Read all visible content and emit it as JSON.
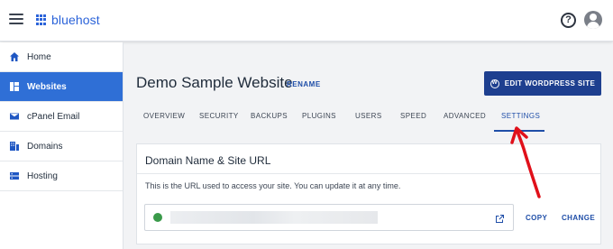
{
  "header": {
    "brand": "bluehost"
  },
  "sidebar": {
    "items": [
      {
        "label": "Home",
        "icon": "home-icon",
        "active": false
      },
      {
        "label": "Websites",
        "icon": "websites-icon",
        "active": true
      },
      {
        "label": "cPanel Email",
        "icon": "email-icon",
        "active": false
      },
      {
        "label": "Domains",
        "icon": "domains-icon",
        "active": false
      },
      {
        "label": "Hosting",
        "icon": "hosting-icon",
        "active": false
      }
    ]
  },
  "page": {
    "title": "Demo Sample Website",
    "rename_label": "RENAME",
    "edit_button_label": "EDIT WORDPRESS SITE"
  },
  "tabs": [
    {
      "label": "OVERVIEW",
      "active": false
    },
    {
      "label": "SECURITY",
      "active": false
    },
    {
      "label": "BACKUPS",
      "active": false
    },
    {
      "label": "PLUGINS",
      "active": false
    },
    {
      "label": "USERS",
      "active": false
    },
    {
      "label": "SPEED",
      "active": false
    },
    {
      "label": "ADVANCED",
      "active": false
    },
    {
      "label": "SETTINGS",
      "active": true
    }
  ],
  "domain_card": {
    "title": "Domain Name & Site URL",
    "description": "This is the URL used to access your site. You can update it at any time.",
    "url_value": "",
    "copy_label": "COPY",
    "change_label": "CHANGE"
  },
  "colors": {
    "brand_blue": "#2b63d9",
    "active_nav": "#2f6fd6",
    "primary_button": "#1e3f8f",
    "link_blue": "#1f4ea8",
    "annotation_red": "#e0101a"
  }
}
